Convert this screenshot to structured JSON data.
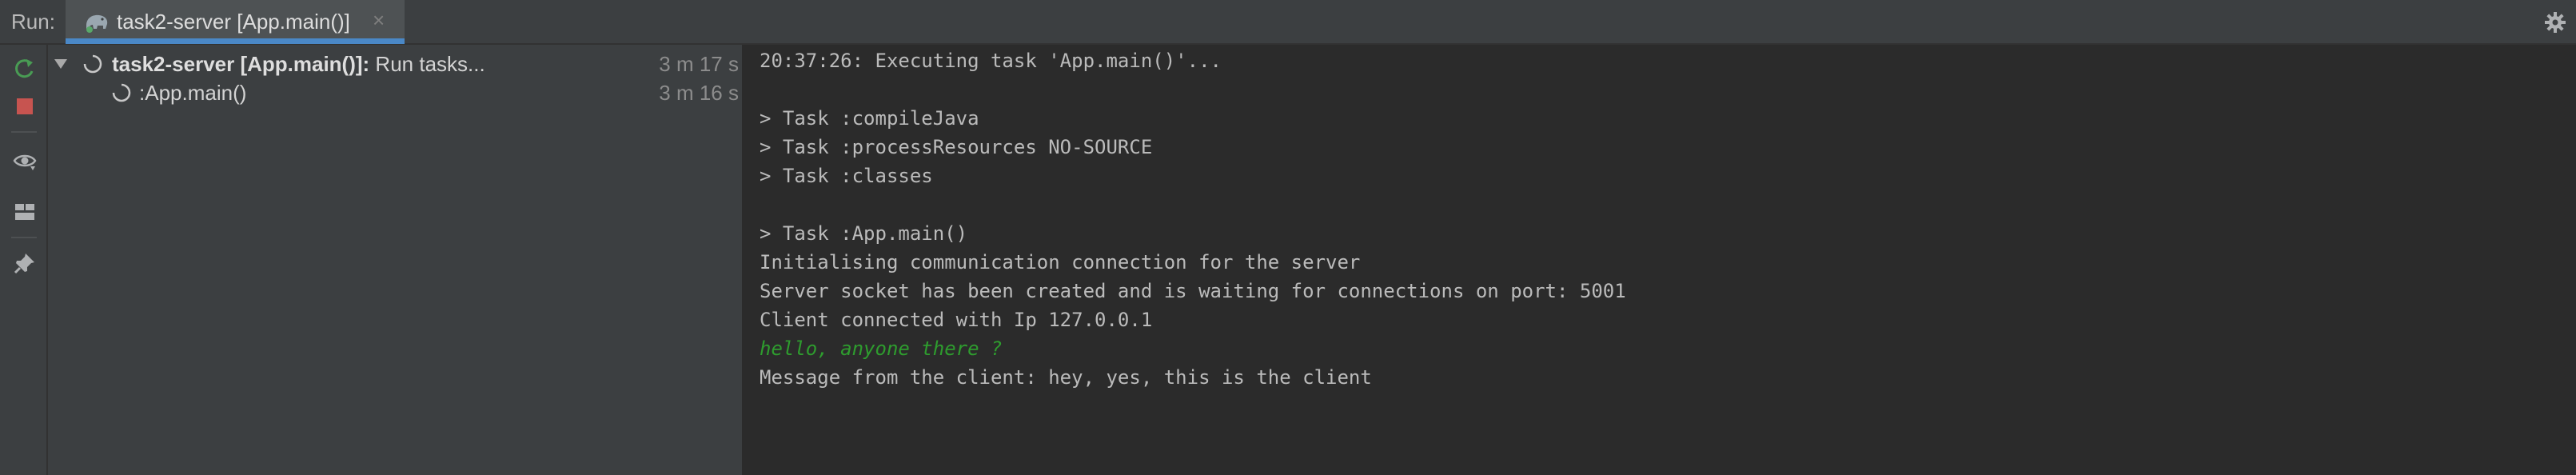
{
  "header": {
    "run_label": "Run:",
    "tab_title": "task2-server [App.main()]",
    "tab_close": "×",
    "tab_icon": "gradle-elephant-icon",
    "settings_icon": "gear-icon"
  },
  "toolbar": {
    "buttons": [
      "rerun-icon",
      "stop-icon",
      "eye-icon",
      "layout-icon",
      "pin-icon"
    ]
  },
  "tree": {
    "root": {
      "name": "task2-server [App.main()]:",
      "status": " Run tasks...",
      "time": "3 m 17 s"
    },
    "child": {
      "name": ":App.main()",
      "time": "3 m 16 s"
    }
  },
  "console": {
    "lines": [
      "20:37:26: Executing task 'App.main()'...",
      "",
      "> Task :compileJava",
      "> Task :processResources NO-SOURCE",
      "> Task :classes",
      "",
      "> Task :App.main()",
      "Initialising communication connection for the server",
      "Server socket has been created and is waiting for connections on port: 5001",
      "Client connected with Ip 127.0.0.1",
      "hello, anyone there ?",
      "Message from the client: hey, yes, this is the client"
    ],
    "input_line_color": "#2e9c2e"
  },
  "colors": {
    "accent": "#4a88c7",
    "stop": "#c75450",
    "rerun": "#499c54"
  }
}
